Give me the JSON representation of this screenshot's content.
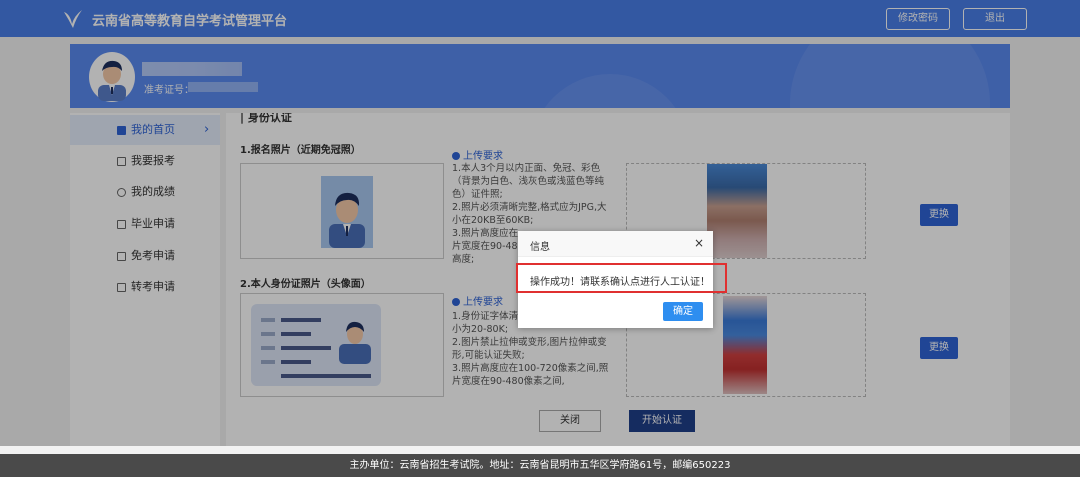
{
  "header": {
    "title": "云南省高等教育自学考试管理平台",
    "change_password": "修改密码",
    "logout": "退出"
  },
  "profile": {
    "ticket_label": "准考证号："
  },
  "sidebar": {
    "items": [
      {
        "label": "我的首页",
        "icon": "home-icon",
        "active": true
      },
      {
        "label": "我要报考",
        "icon": "register-icon"
      },
      {
        "label": "我的成绩",
        "icon": "user-icon"
      },
      {
        "label": "毕业申请",
        "icon": "graduate-icon"
      },
      {
        "label": "免考申请",
        "icon": "exempt-icon"
      },
      {
        "label": "转考申请",
        "icon": "transfer-icon"
      }
    ],
    "chevron": "›"
  },
  "main": {
    "section_title": "| 身份认证",
    "photo_section": {
      "title": "1.报名照片（近期免冠照）",
      "req_title": "上传要求",
      "req_text": "1.本人3个月以内正面、免冠、彩色（背景为白色、浅灰色或浅蓝色等纯色）证件照;\n2.照片必须清晰完整,格式应为JPG,大小在20KB至60KB;\n3.照片高度应在\n片宽度在90-480\n高度;",
      "change": "更换"
    },
    "id_section": {
      "title": "2.本人身份证照片（头像面）",
      "req_title": "上传要求",
      "req_text": "1.身份证字体清\n小为20-80K;\n2.图片禁止拉伸或变形,图片拉伸或变形,可能认证失败;\n3.照片高度应在100-720像素之间,照片宽度在90-480像素之间,",
      "change": "更换"
    },
    "close": "关闭",
    "start": "开始认证"
  },
  "dialog": {
    "title": "信息",
    "close": "×",
    "message": "操作成功！请联系确认点进行人工认证！",
    "ok": "确定"
  },
  "footer": {
    "text": "主办单位：云南省招生考试院。地址：云南省昆明市五华区学府路61号，邮编650223"
  },
  "colors": {
    "primary": "#4a7fe8",
    "accent_blue": "#2e63d6",
    "highlight_red": "#e03030",
    "footer": "#4a4a4a"
  }
}
